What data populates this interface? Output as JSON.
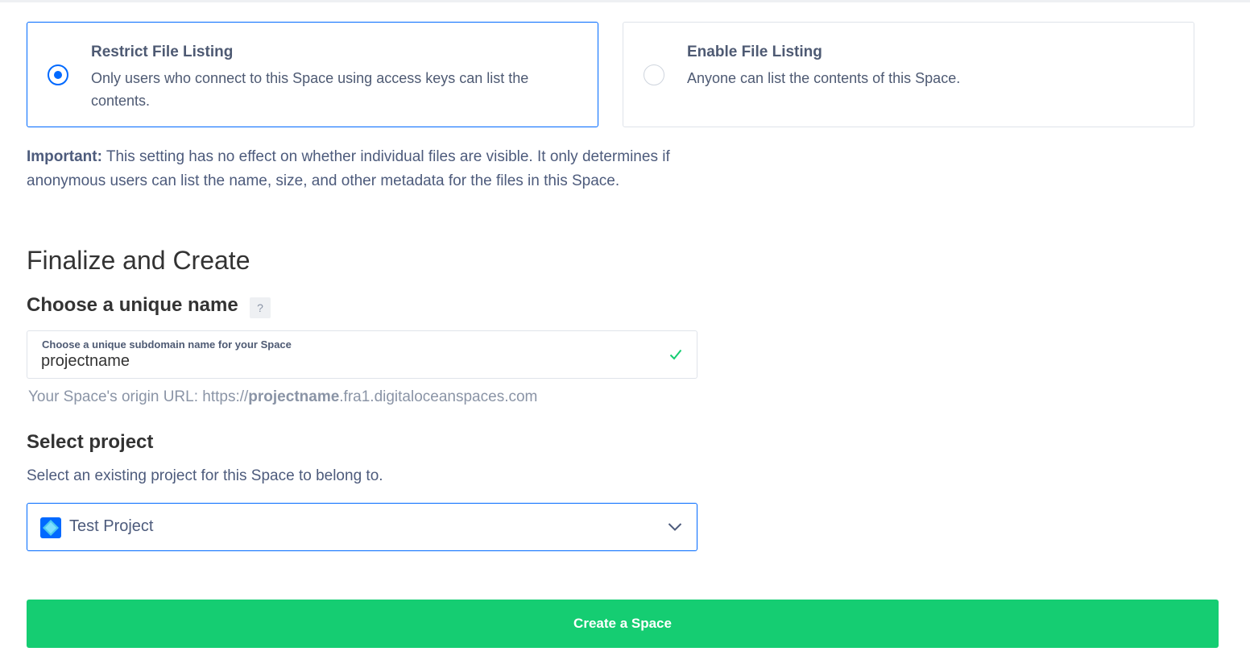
{
  "colors": {
    "accent": "#0069ff",
    "success": "#15cd72",
    "text": "#4d5b7c"
  },
  "file_listing": {
    "options": [
      {
        "title": "Restrict File Listing",
        "description": "Only users who connect to this Space using access keys can list the contents.",
        "selected": true
      },
      {
        "title": "Enable File Listing",
        "description": "Anyone can list the contents of this Space.",
        "selected": false
      }
    ],
    "note_label": "Important:",
    "note_text": " This setting has no effect on whether individual files are visible. It only determines if anonymous users can list the name, size, and other metadata for the files in this Space."
  },
  "finalize": {
    "title": "Finalize and Create",
    "name_section": {
      "title": "Choose a unique name",
      "help_icon": "question-mark-icon",
      "help_text": "?",
      "field_label": "Choose a unique subdomain name for your Space",
      "field_value": "projectname",
      "valid_icon": "check-icon",
      "origin_prefix": "Your Space's origin URL: https://",
      "origin_name": "projectname",
      "origin_suffix": ".fra1.digitaloceanspaces.com"
    },
    "project_section": {
      "title": "Select project",
      "description": "Select an existing project for this Space to belong to.",
      "selected_project": "Test Project",
      "project_icon": "project-diamond-icon",
      "dropdown_icon": "chevron-down-icon"
    },
    "submit_label": "Create a Space"
  }
}
